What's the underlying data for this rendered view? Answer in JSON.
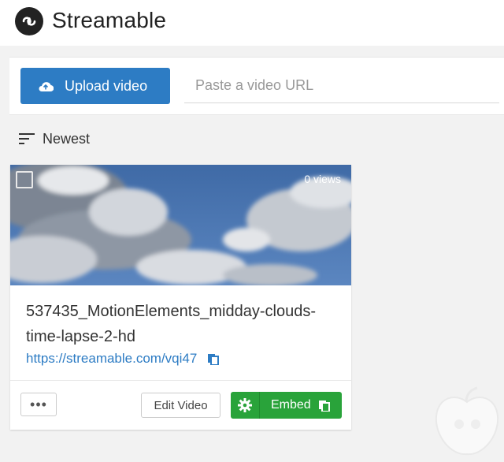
{
  "header": {
    "brand": "Streamable",
    "logo_icon": "infinity-logo-icon"
  },
  "upload": {
    "button_label": "Upload video",
    "url_placeholder": "Paste a video URL",
    "url_value": ""
  },
  "sort": {
    "label": "Newest",
    "icon": "sort-lines-icon"
  },
  "video_card": {
    "views": "0 views",
    "title": "537435_MotionElements_midday-clouds-time-lapse-2-hd",
    "link": "https://streamable.com/vqi47",
    "more_label": "•••",
    "edit_label": "Edit Video",
    "embed_label": "Embed"
  },
  "colors": {
    "primary_blue": "#2d7cc4",
    "embed_green": "#29a33a"
  }
}
